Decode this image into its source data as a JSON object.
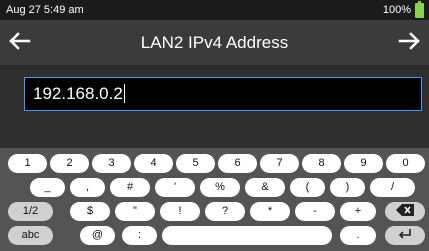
{
  "status_bar": {
    "time": "Aug 27 5:49 am",
    "battery_percent": "100%",
    "battery_color": "#8bd24a"
  },
  "header": {
    "title": "LAN2 IPv4 Address",
    "back_icon": "arrow-left-icon",
    "forward_icon": "arrow-right-icon"
  },
  "address_input": {
    "value": "192.168.0.2",
    "border_color": "#3aa0ff"
  },
  "keyboard": {
    "row1": [
      "1",
      "2",
      "3",
      "4",
      "5",
      "6",
      "7",
      "8",
      "9",
      "0"
    ],
    "row2": [
      "_",
      ",",
      "#",
      "'",
      "%",
      "&",
      "(",
      ")",
      "/"
    ],
    "row3": [
      "1/2",
      "$",
      "\"",
      "!",
      "?",
      "*",
      "-",
      "+",
      "backspace-icon"
    ],
    "row4": [
      "abc",
      "@",
      ":",
      "space",
      ".",
      "enter-icon"
    ]
  }
}
